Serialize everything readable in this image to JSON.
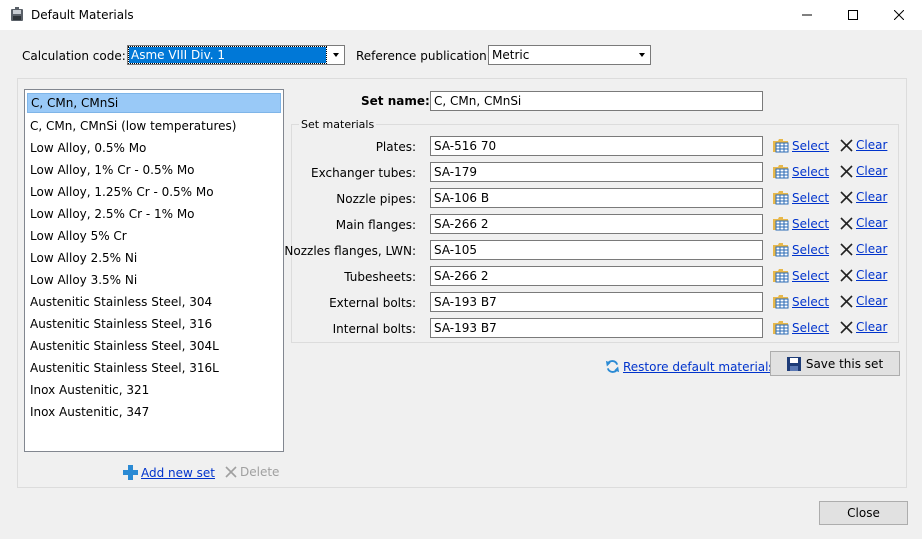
{
  "window": {
    "title": "Default Materials",
    "icon": "app-disk-icon"
  },
  "header": {
    "calc_code_label": "Calculation code:",
    "calc_code_value": "Asme VIII Div. 1",
    "ref_pub_label": "Reference publication:",
    "ref_pub_value": "Metric"
  },
  "sets": {
    "items": [
      "C, CMn, CMnSi",
      "C, CMn, CMnSi (low temperatures)",
      "Low Alloy, 0.5% Mo",
      "Low Alloy, 1% Cr - 0.5% Mo",
      "Low Alloy, 1.25% Cr - 0.5% Mo",
      "Low Alloy, 2.5% Cr - 1% Mo",
      "Low Alloy 5% Cr",
      "Low Alloy 2.5% Ni",
      "Low Alloy 3.5% Ni",
      "Austenitic Stainless Steel, 304",
      "Austenitic Stainless Steel, 316",
      "Austenitic Stainless Steel, 304L",
      "Austenitic Stainless Steel, 316L",
      "Inox Austenitic, 321",
      "Inox Austenitic, 347"
    ],
    "selected_index": 0,
    "add_label": "Add new set",
    "delete_label": "Delete"
  },
  "set_detail": {
    "name_label": "Set name:",
    "name_value": "C, CMn, CMnSi",
    "group_label": "Set materials",
    "select_label": "Select",
    "clear_label": "Clear",
    "rows": [
      {
        "label": "Plates:",
        "value": "SA-516 70"
      },
      {
        "label": "Exchanger tubes:",
        "value": "SA-179"
      },
      {
        "label": "Nozzle pipes:",
        "value": "SA-106 B"
      },
      {
        "label": "Main flanges:",
        "value": "SA-266 2"
      },
      {
        "label": "Nozzles flanges, LWN:",
        "value": "SA-105"
      },
      {
        "label": "Tubesheets:",
        "value": "SA-266 2"
      },
      {
        "label": "External bolts:",
        "value": "SA-193 B7"
      },
      {
        "label": "Internal bolts:",
        "value": "SA-193 B7"
      }
    ],
    "restore_label": "Restore default materials",
    "save_label": "Save this set"
  },
  "footer": {
    "close_label": "Close"
  },
  "colors": {
    "selection": "#0078d7",
    "list_selection": "#99c9f7",
    "link": "#0033cc"
  }
}
